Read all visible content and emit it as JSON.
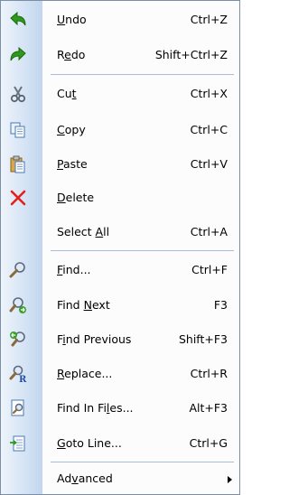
{
  "menu": {
    "items": [
      {
        "pre": "",
        "acc": "U",
        "post": "ndo",
        "shortcut": "Ctrl+Z",
        "icon": "undo-arrow-icon"
      },
      {
        "pre": "R",
        "acc": "e",
        "post": "do",
        "shortcut": "Shift+Ctrl+Z",
        "icon": "redo-arrow-icon"
      },
      {
        "pre": "Cu",
        "acc": "t",
        "post": "",
        "shortcut": "Ctrl+X",
        "icon": "scissors-icon"
      },
      {
        "pre": "",
        "acc": "C",
        "post": "opy",
        "shortcut": "Ctrl+C",
        "icon": "copy-documents-icon"
      },
      {
        "pre": "",
        "acc": "P",
        "post": "aste",
        "shortcut": "Ctrl+V",
        "icon": "clipboard-paste-icon"
      },
      {
        "pre": "",
        "acc": "D",
        "post": "elete",
        "shortcut": "",
        "icon": "red-x-delete-icon"
      },
      {
        "pre": "Select ",
        "acc": "A",
        "post": "ll",
        "shortcut": "Ctrl+A",
        "icon": ""
      },
      {
        "pre": "",
        "acc": "F",
        "post": "ind...",
        "shortcut": "Ctrl+F",
        "icon": "magnifier-icon"
      },
      {
        "pre": "Find ",
        "acc": "N",
        "post": "ext",
        "shortcut": "F3",
        "icon": "find-next-icon"
      },
      {
        "pre": "F",
        "acc": "i",
        "post": "nd Previous",
        "shortcut": "Shift+F3",
        "icon": "find-previous-icon"
      },
      {
        "pre": "",
        "acc": "R",
        "post": "eplace...",
        "shortcut": "Ctrl+R",
        "icon": "replace-icon"
      },
      {
        "pre": "Find In Fi",
        "acc": "l",
        "post": "es...",
        "shortcut": "Alt+F3",
        "icon": "find-in-files-icon"
      },
      {
        "pre": "",
        "acc": "G",
        "post": "oto Line...",
        "shortcut": "Ctrl+G",
        "icon": "goto-line-icon"
      },
      {
        "pre": "Ad",
        "acc": "v",
        "post": "anced",
        "shortcut": "",
        "icon": "",
        "submenu": "submenu-arrow-icon"
      }
    ]
  },
  "colors": {
    "border": "#7a8ea8",
    "gutter_light": "#eef4fb",
    "gutter_dark": "#c3d6ee",
    "separator": "#a8bdd8",
    "delete_red": "#e3201b",
    "arrow_green": "#2e9a1c"
  }
}
